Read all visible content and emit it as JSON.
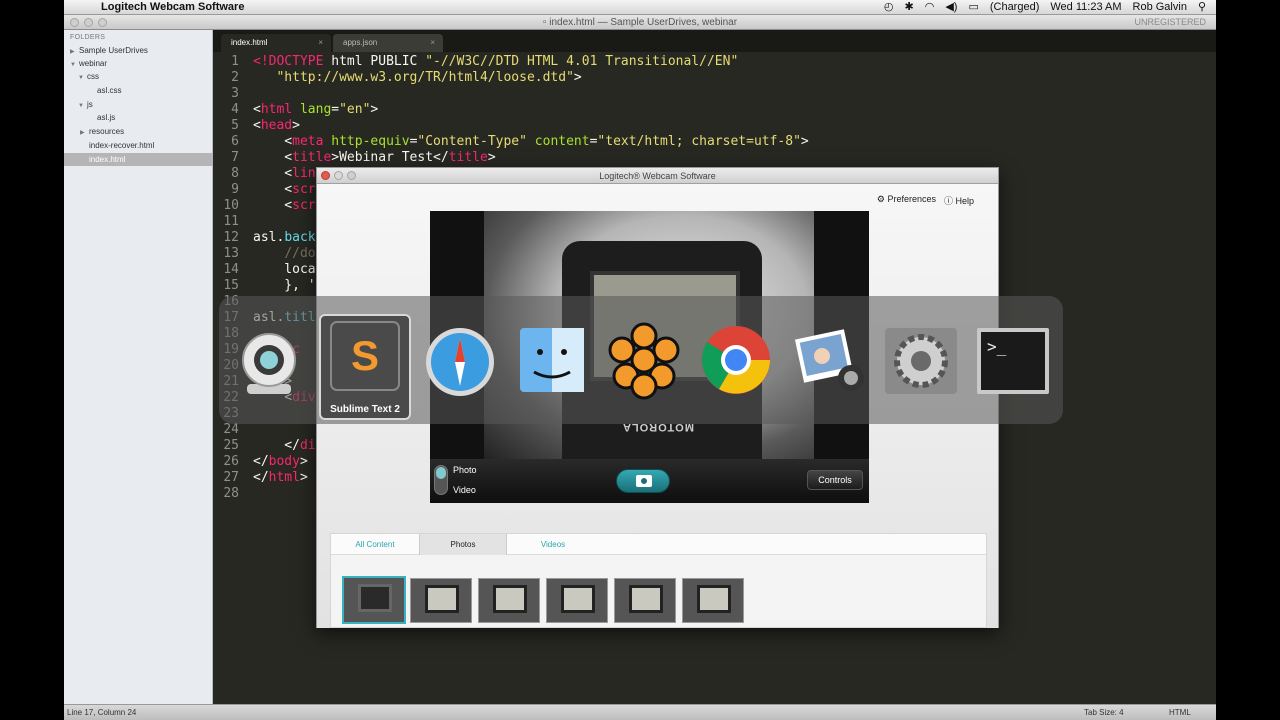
{
  "menubar": {
    "app_name": "Logitech Webcam Software",
    "battery": "(Charged)",
    "clock": "Wed 11:23 AM",
    "user": "Rob Galvin"
  },
  "editor": {
    "window_title": "index.html — Sample UserDrives, webinar",
    "unregistered": "UNREGISTERED",
    "sidebar": {
      "header": "FOLDERS",
      "items": [
        {
          "label": "Sample UserDrives",
          "expanded": false
        },
        {
          "label": "webinar",
          "expanded": true
        },
        {
          "label": "css",
          "expanded": true
        },
        {
          "label": "asl.css"
        },
        {
          "label": "js",
          "expanded": true
        },
        {
          "label": "asl.js"
        },
        {
          "label": "resources",
          "expanded": false
        },
        {
          "label": "index-recover.html"
        },
        {
          "label": "index.html",
          "selected": true
        }
      ]
    },
    "tabs": [
      {
        "label": "index.html",
        "active": true,
        "close": "×"
      },
      {
        "label": "apps.json",
        "active": false,
        "close": "×"
      }
    ],
    "line_numbers": [
      "1",
      "2",
      "3",
      "4",
      "5",
      "6",
      "7",
      "8",
      "9",
      "10",
      "11",
      "12",
      "13",
      "14",
      "15",
      "16",
      "17",
      "18",
      "19",
      "20",
      "21",
      "22",
      "23",
      "24",
      "25",
      "26",
      "27",
      "28"
    ],
    "status": {
      "position": "Line 17, Column 24",
      "tab_size": "Tab Size: 4",
      "syntax": "HTML"
    }
  },
  "webcam": {
    "title": "Logitech® Webcam Software",
    "preferences": "Preferences",
    "help": "Help",
    "mode_photo": "Photo",
    "mode_video": "Video",
    "controls": "Controls",
    "phone_brand": "MOTOROLA",
    "gallery_tabs": [
      "All Content",
      "Photos",
      "Videos"
    ],
    "selected_gallery_tab": "Photos"
  },
  "switcher": {
    "selected_label": "Sublime Text 2",
    "apps": [
      "webcam",
      "sublime-text",
      "safari",
      "finder",
      "photo-booth-flower",
      "chrome",
      "iphoto",
      "system-preferences",
      "terminal"
    ]
  },
  "colors": {
    "tag": "#f92672",
    "attr": "#a6e22e",
    "string": "#e6db74",
    "accent": "#36b3bf"
  }
}
